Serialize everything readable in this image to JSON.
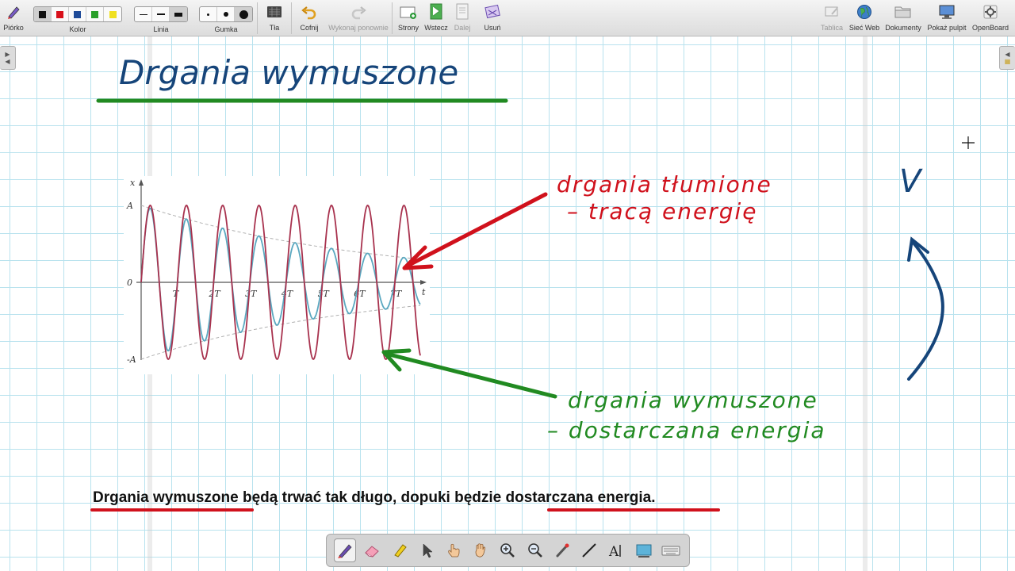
{
  "toolbar": {
    "pen_label": "Piórko",
    "color_label": "Kolor",
    "colors": [
      "#111111",
      "#d8101a",
      "#1f4b99",
      "#2aa02a",
      "#f0e020"
    ],
    "line_label": "Linia",
    "eraser_label": "Gumka",
    "backgrounds_label": "Tła",
    "undo_label": "Cofnij",
    "redo_label": "Wykonaj ponownie",
    "pages_label": "Strony",
    "back_label": "Wstecz",
    "next_label": "Dalej",
    "delete_label": "Usuń",
    "board_label": "Tablica",
    "web_label": "Sieć Web",
    "documents_label": "Dokumenty",
    "desktop_label": "Pokaż pulpit",
    "openboard_label": "OpenBoard"
  },
  "board": {
    "title": "Drgania wymuszone",
    "damped_label_line1": "drgania tłumione",
    "damped_label_line2": "– tracą energię",
    "forced_label_line1": "drgania wymuszone",
    "forced_label_line2": "– dostarczana energia",
    "check_mark": "V",
    "caption": {
      "highlight1": "Drgania wymuszone",
      "middle": " będą trwać tak długo, dopuki będzie ",
      "highlight2": "dostarczana energia."
    },
    "colors": {
      "blue_ink": "#16457a",
      "red_ink": "#d0111c",
      "green_ink": "#218a21"
    }
  },
  "chart_data": {
    "type": "line",
    "xlabel": "t",
    "ylabel": "x",
    "x_ticks": [
      "T",
      "2T",
      "3T",
      "4T",
      "5T",
      "6T",
      "7T"
    ],
    "y_ticks": [
      "A",
      "0",
      "-A"
    ],
    "xlim": [
      0,
      7.7
    ],
    "ylim": [
      -1,
      1
    ],
    "series": [
      {
        "type": "forced",
        "amplitude": 1.0,
        "period": 1.0,
        "color": "#a8324e"
      },
      {
        "type": "damped",
        "amplitude": 1.0,
        "period": 1.0,
        "envelope_end": 0.3,
        "color": "#5aa8c0"
      }
    ],
    "envelope_color": "#b0b0b0"
  },
  "dock": {
    "tools": [
      "pen-tool",
      "eraser-tool",
      "marker-tool",
      "selector-tool",
      "interactor-tool",
      "hand-tool",
      "zoom-in-tool",
      "zoom-out-tool",
      "laser-pointer-tool",
      "line-tool",
      "text-tool",
      "capture-tool",
      "keyboard-tool"
    ]
  }
}
